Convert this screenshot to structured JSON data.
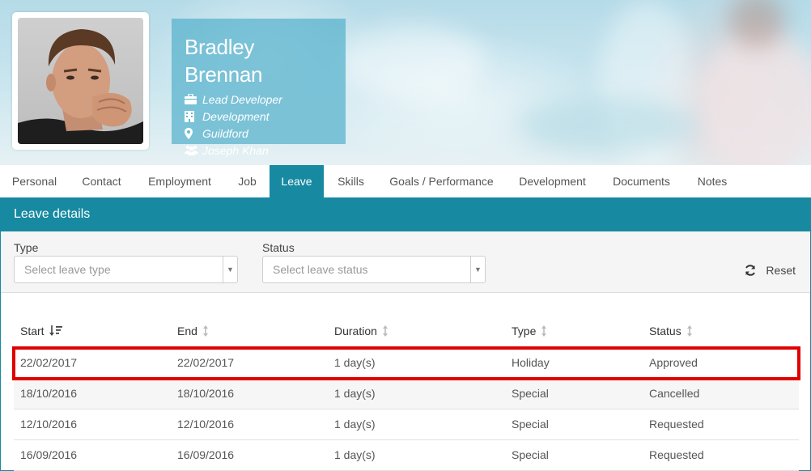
{
  "profile": {
    "name": "Bradley Brennan",
    "job_title": "Lead Developer",
    "department": "Development",
    "location": "Guildford",
    "manager": "Joseph Khan"
  },
  "tabs": [
    {
      "label": "Personal",
      "active": false
    },
    {
      "label": "Contact",
      "active": false
    },
    {
      "label": "Employment",
      "active": false
    },
    {
      "label": "Job",
      "active": false
    },
    {
      "label": "Leave",
      "active": true
    },
    {
      "label": "Skills",
      "active": false
    },
    {
      "label": "Goals / Performance",
      "active": false
    },
    {
      "label": "Development",
      "active": false
    },
    {
      "label": "Documents",
      "active": false
    },
    {
      "label": "Notes",
      "active": false
    }
  ],
  "panel": {
    "title": "Leave details",
    "filters": {
      "type_label": "Type",
      "type_placeholder": "Select leave type",
      "status_label": "Status",
      "status_placeholder": "Select leave status",
      "reset_label": "Reset"
    }
  },
  "table": {
    "columns": [
      "Start",
      "End",
      "Duration",
      "Type",
      "Status"
    ],
    "rows": [
      [
        "22/02/2017",
        "22/02/2017",
        "1 day(s)",
        "Holiday",
        "Approved"
      ],
      [
        "18/10/2016",
        "18/10/2016",
        "1 day(s)",
        "Special",
        "Cancelled"
      ],
      [
        "12/10/2016",
        "12/10/2016",
        "1 day(s)",
        "Special",
        "Requested"
      ],
      [
        "16/09/2016",
        "16/09/2016",
        "1 day(s)",
        "Special",
        "Requested"
      ]
    ]
  },
  "colors": {
    "accent": "#1789a1",
    "highlight": "#e00000"
  }
}
